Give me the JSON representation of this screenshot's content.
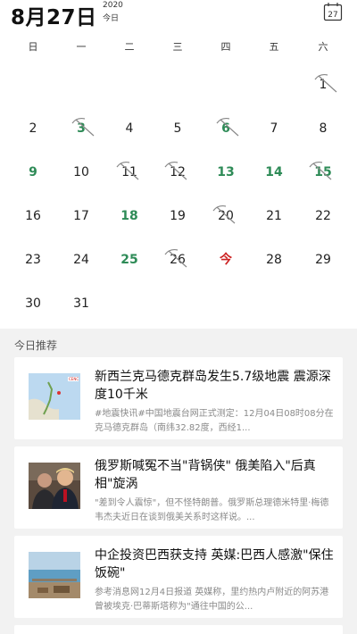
{
  "header": {
    "date": "8月27日",
    "year": "2020",
    "today_label": "今日",
    "calendar_icon_day": "27"
  },
  "weekdays": [
    "日",
    "一",
    "二",
    "三",
    "四",
    "五",
    "六"
  ],
  "days": [
    {
      "label": "1",
      "style": "normal",
      "marked": true
    },
    {
      "label": "2",
      "style": "normal",
      "marked": false
    },
    {
      "label": "3",
      "style": "green",
      "marked": true
    },
    {
      "label": "4",
      "style": "normal",
      "marked": false
    },
    {
      "label": "5",
      "style": "normal",
      "marked": false
    },
    {
      "label": "6",
      "style": "green",
      "marked": true
    },
    {
      "label": "7",
      "style": "normal",
      "marked": false
    },
    {
      "label": "8",
      "style": "normal",
      "marked": false
    },
    {
      "label": "9",
      "style": "green",
      "marked": false
    },
    {
      "label": "10",
      "style": "normal",
      "marked": false
    },
    {
      "label": "11",
      "style": "normal",
      "marked": true
    },
    {
      "label": "12",
      "style": "normal",
      "marked": true
    },
    {
      "label": "13",
      "style": "green",
      "marked": false
    },
    {
      "label": "14",
      "style": "green",
      "marked": false
    },
    {
      "label": "15",
      "style": "green",
      "marked": true
    },
    {
      "label": "16",
      "style": "normal",
      "marked": false
    },
    {
      "label": "17",
      "style": "normal",
      "marked": false
    },
    {
      "label": "18",
      "style": "green",
      "marked": false
    },
    {
      "label": "19",
      "style": "normal",
      "marked": false
    },
    {
      "label": "20",
      "style": "normal",
      "marked": true
    },
    {
      "label": "21",
      "style": "normal",
      "marked": false
    },
    {
      "label": "22",
      "style": "normal",
      "marked": false
    },
    {
      "label": "23",
      "style": "normal",
      "marked": false
    },
    {
      "label": "24",
      "style": "normal",
      "marked": false
    },
    {
      "label": "25",
      "style": "green",
      "marked": false
    },
    {
      "label": "26",
      "style": "normal",
      "marked": true
    },
    {
      "label": "今",
      "style": "red",
      "marked": false
    },
    {
      "label": "28",
      "style": "normal",
      "marked": false
    },
    {
      "label": "29",
      "style": "normal",
      "marked": false
    },
    {
      "label": "30",
      "style": "normal",
      "marked": false
    },
    {
      "label": "31",
      "style": "normal",
      "marked": false
    }
  ],
  "first_weekday_index": 6,
  "colors": {
    "green": "#2e8b57",
    "today_red": "#cc2222",
    "section_bg": "#f2f2f2"
  },
  "recommend": {
    "title": "今日推荐",
    "cards": [
      {
        "title": "新西兰克马德克群岛发生5.7级地震 震源深度10千米",
        "desc": "#地震快讯#中国地震台网正式测定：12月04日08时08分在克马德克群岛（南纬32.82度，西经1...",
        "thumb_icon": "map-thumbnail"
      },
      {
        "title": "俄罗斯喊冤不当\"背锅侠\" 俄美陷入\"后真相\"旋涡",
        "desc": "\"差到令人震惊\"，但不怪特朗普。俄罗斯总理德米特里·梅德韦杰夫近日在谈到俄美关系时这样说。...",
        "thumb_icon": "people-thumbnail"
      },
      {
        "title": "中企投资巴西获支持 英媒:巴西人感激\"保住饭碗\"",
        "desc": "参考消息网12月4日报道 英媒称，里约热内卢附近的阿苏港曾被埃克·巴蒂斯塔称为\"通往中国的公...",
        "thumb_icon": "port-thumbnail"
      }
    ]
  }
}
